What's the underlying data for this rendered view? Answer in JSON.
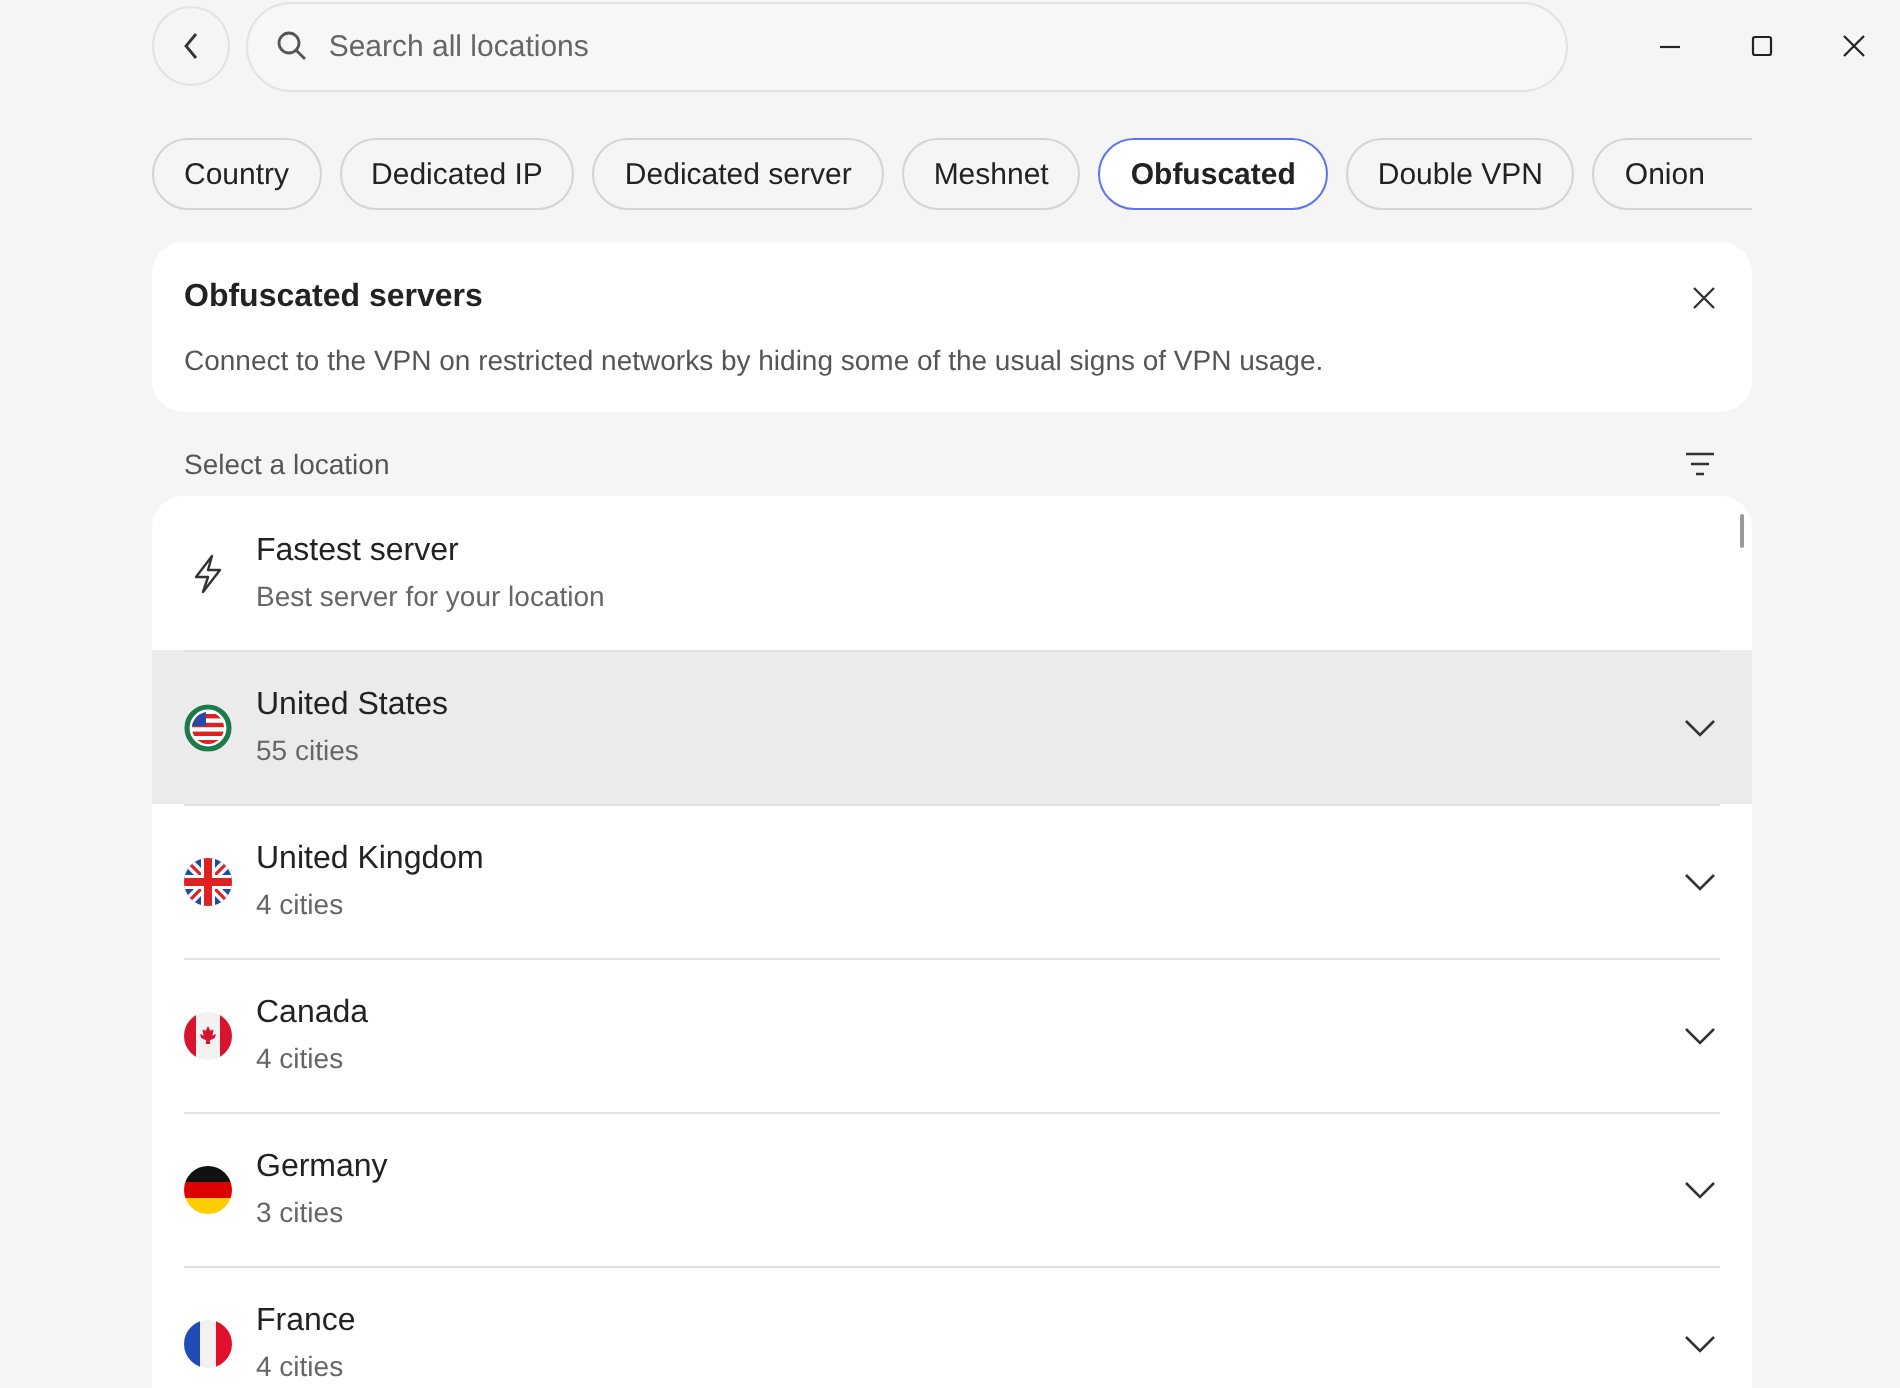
{
  "search": {
    "placeholder": "Search all locations"
  },
  "filters": [
    {
      "label": "Country",
      "selected": false
    },
    {
      "label": "Dedicated IP",
      "selected": false
    },
    {
      "label": "Dedicated server",
      "selected": false
    },
    {
      "label": "Meshnet",
      "selected": false
    },
    {
      "label": "Obfuscated",
      "selected": true
    },
    {
      "label": "Double VPN",
      "selected": false
    },
    {
      "label": "Onion",
      "selected": false
    }
  ],
  "info_card": {
    "title": "Obfuscated servers",
    "description": "Connect to the VPN on restricted networks by hiding some of the usual signs of VPN usage."
  },
  "list_header": {
    "label": "Select a location"
  },
  "locations": [
    {
      "kind": "fastest",
      "name": "Fastest server",
      "detail": "Best server for your location",
      "selected": false
    },
    {
      "kind": "country",
      "name": "United States",
      "detail": "55 cities",
      "selected": true,
      "connected": true
    },
    {
      "kind": "country",
      "name": "United Kingdom",
      "detail": "4 cities",
      "selected": false,
      "connected": false
    },
    {
      "kind": "country",
      "name": "Canada",
      "detail": "4 cities",
      "selected": false,
      "connected": false
    },
    {
      "kind": "country",
      "name": "Germany",
      "detail": "3 cities",
      "selected": false,
      "connected": false
    },
    {
      "kind": "country",
      "name": "France",
      "detail": "4 cities",
      "selected": false,
      "connected": false
    }
  ]
}
